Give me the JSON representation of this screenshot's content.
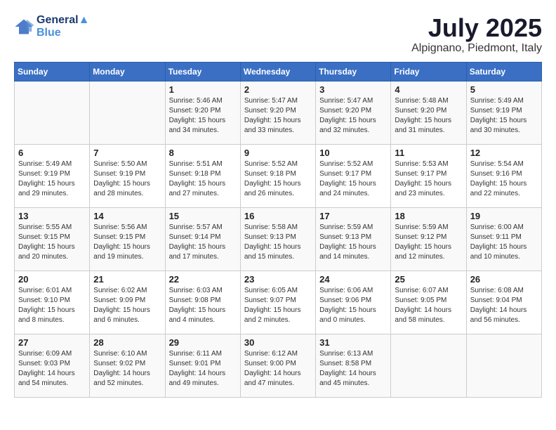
{
  "logo": {
    "line1": "General",
    "line2": "Blue"
  },
  "title": "July 2025",
  "location": "Alpignano, Piedmont, Italy",
  "weekdays": [
    "Sunday",
    "Monday",
    "Tuesday",
    "Wednesday",
    "Thursday",
    "Friday",
    "Saturday"
  ],
  "weeks": [
    [
      {
        "day": "",
        "info": ""
      },
      {
        "day": "",
        "info": ""
      },
      {
        "day": "1",
        "info": "Sunrise: 5:46 AM\nSunset: 9:20 PM\nDaylight: 15 hours and 34 minutes."
      },
      {
        "day": "2",
        "info": "Sunrise: 5:47 AM\nSunset: 9:20 PM\nDaylight: 15 hours and 33 minutes."
      },
      {
        "day": "3",
        "info": "Sunrise: 5:47 AM\nSunset: 9:20 PM\nDaylight: 15 hours and 32 minutes."
      },
      {
        "day": "4",
        "info": "Sunrise: 5:48 AM\nSunset: 9:20 PM\nDaylight: 15 hours and 31 minutes."
      },
      {
        "day": "5",
        "info": "Sunrise: 5:49 AM\nSunset: 9:19 PM\nDaylight: 15 hours and 30 minutes."
      }
    ],
    [
      {
        "day": "6",
        "info": "Sunrise: 5:49 AM\nSunset: 9:19 PM\nDaylight: 15 hours and 29 minutes."
      },
      {
        "day": "7",
        "info": "Sunrise: 5:50 AM\nSunset: 9:19 PM\nDaylight: 15 hours and 28 minutes."
      },
      {
        "day": "8",
        "info": "Sunrise: 5:51 AM\nSunset: 9:18 PM\nDaylight: 15 hours and 27 minutes."
      },
      {
        "day": "9",
        "info": "Sunrise: 5:52 AM\nSunset: 9:18 PM\nDaylight: 15 hours and 26 minutes."
      },
      {
        "day": "10",
        "info": "Sunrise: 5:52 AM\nSunset: 9:17 PM\nDaylight: 15 hours and 24 minutes."
      },
      {
        "day": "11",
        "info": "Sunrise: 5:53 AM\nSunset: 9:17 PM\nDaylight: 15 hours and 23 minutes."
      },
      {
        "day": "12",
        "info": "Sunrise: 5:54 AM\nSunset: 9:16 PM\nDaylight: 15 hours and 22 minutes."
      }
    ],
    [
      {
        "day": "13",
        "info": "Sunrise: 5:55 AM\nSunset: 9:15 PM\nDaylight: 15 hours and 20 minutes."
      },
      {
        "day": "14",
        "info": "Sunrise: 5:56 AM\nSunset: 9:15 PM\nDaylight: 15 hours and 19 minutes."
      },
      {
        "day": "15",
        "info": "Sunrise: 5:57 AM\nSunset: 9:14 PM\nDaylight: 15 hours and 17 minutes."
      },
      {
        "day": "16",
        "info": "Sunrise: 5:58 AM\nSunset: 9:13 PM\nDaylight: 15 hours and 15 minutes."
      },
      {
        "day": "17",
        "info": "Sunrise: 5:59 AM\nSunset: 9:13 PM\nDaylight: 15 hours and 14 minutes."
      },
      {
        "day": "18",
        "info": "Sunrise: 5:59 AM\nSunset: 9:12 PM\nDaylight: 15 hours and 12 minutes."
      },
      {
        "day": "19",
        "info": "Sunrise: 6:00 AM\nSunset: 9:11 PM\nDaylight: 15 hours and 10 minutes."
      }
    ],
    [
      {
        "day": "20",
        "info": "Sunrise: 6:01 AM\nSunset: 9:10 PM\nDaylight: 15 hours and 8 minutes."
      },
      {
        "day": "21",
        "info": "Sunrise: 6:02 AM\nSunset: 9:09 PM\nDaylight: 15 hours and 6 minutes."
      },
      {
        "day": "22",
        "info": "Sunrise: 6:03 AM\nSunset: 9:08 PM\nDaylight: 15 hours and 4 minutes."
      },
      {
        "day": "23",
        "info": "Sunrise: 6:05 AM\nSunset: 9:07 PM\nDaylight: 15 hours and 2 minutes."
      },
      {
        "day": "24",
        "info": "Sunrise: 6:06 AM\nSunset: 9:06 PM\nDaylight: 15 hours and 0 minutes."
      },
      {
        "day": "25",
        "info": "Sunrise: 6:07 AM\nSunset: 9:05 PM\nDaylight: 14 hours and 58 minutes."
      },
      {
        "day": "26",
        "info": "Sunrise: 6:08 AM\nSunset: 9:04 PM\nDaylight: 14 hours and 56 minutes."
      }
    ],
    [
      {
        "day": "27",
        "info": "Sunrise: 6:09 AM\nSunset: 9:03 PM\nDaylight: 14 hours and 54 minutes."
      },
      {
        "day": "28",
        "info": "Sunrise: 6:10 AM\nSunset: 9:02 PM\nDaylight: 14 hours and 52 minutes."
      },
      {
        "day": "29",
        "info": "Sunrise: 6:11 AM\nSunset: 9:01 PM\nDaylight: 14 hours and 49 minutes."
      },
      {
        "day": "30",
        "info": "Sunrise: 6:12 AM\nSunset: 9:00 PM\nDaylight: 14 hours and 47 minutes."
      },
      {
        "day": "31",
        "info": "Sunrise: 6:13 AM\nSunset: 8:58 PM\nDaylight: 14 hours and 45 minutes."
      },
      {
        "day": "",
        "info": ""
      },
      {
        "day": "",
        "info": ""
      }
    ]
  ]
}
